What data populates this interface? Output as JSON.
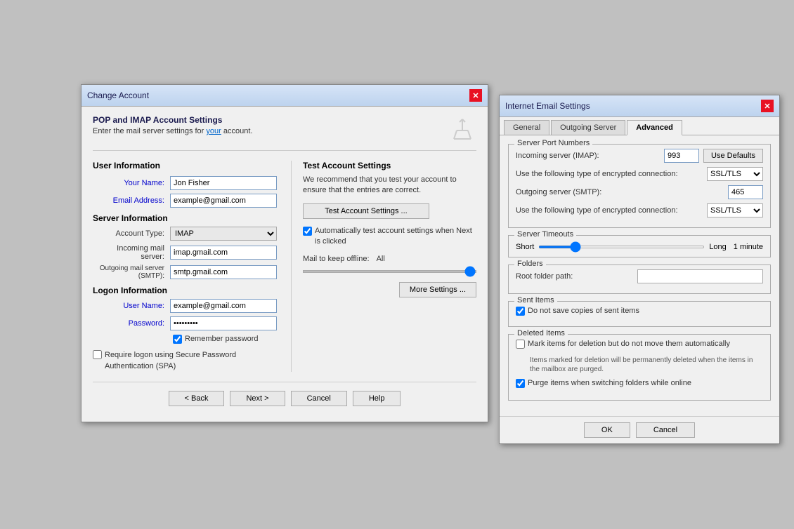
{
  "changeAccount": {
    "title": "Change Account",
    "header": {
      "heading": "POP and IMAP Account Settings",
      "subtext": "Enter the mail server settings for ",
      "link": "your",
      "subtext2": " account."
    },
    "userInfo": {
      "sectionLabel": "User Information",
      "yourNameLabel": "Your Name:",
      "yourNameValue": "Jon Fisher",
      "emailAddressLabel": "Email Address:",
      "emailAddressValue": "example@gmail.com"
    },
    "serverInfo": {
      "sectionLabel": "Server Information",
      "accountTypeLabel": "Account Type:",
      "accountTypeValue": "IMAP",
      "incomingLabel": "Incoming mail server:",
      "incomingValue": "imap.gmail.com",
      "outgoingLabel": "Outgoing mail server (SMTP):",
      "outgoingValue": "smtp.gmail.com"
    },
    "logonInfo": {
      "sectionLabel": "Logon Information",
      "userNameLabel": "User Name:",
      "userNameValue": "example@gmail.com",
      "passwordLabel": "Password:",
      "passwordValue": "********",
      "rememberPassword": "Remember password",
      "spaLabel": "Require logon using Secure Password Authentication (SPA)"
    },
    "testAccountSettings": {
      "title": "Test Account Settings",
      "description": "We recommend that you test your account to ensure that the entries are correct.",
      "testBtnLabel": "Test Account Settings ...",
      "autoTestLabel": "Automatically test account settings when Next is clicked",
      "autoTestChecked": true,
      "mailOfflineLabel": "Mail to keep offline:",
      "mailOfflineValue": "All",
      "moreSettingsLabel": "More Settings ..."
    },
    "buttons": {
      "back": "< Back",
      "next": "Next >",
      "cancel": "Cancel",
      "help": "Help"
    }
  },
  "emailSettings": {
    "title": "Internet Email Settings",
    "tabs": [
      {
        "label": "General",
        "active": false
      },
      {
        "label": "Outgoing Server",
        "active": false
      },
      {
        "label": "Advanced",
        "active": true
      }
    ],
    "serverPortNumbers": {
      "groupTitle": "Server Port Numbers",
      "incomingLabel": "Incoming server (IMAP):",
      "incomingValue": "993",
      "useDefaultsLabel": "Use Defaults",
      "encryptedLabel1": "Use the following type of encrypted connection:",
      "encryptedValue1": "SSL/TLS",
      "outgoingLabel": "Outgoing server (SMTP):",
      "outgoingValue": "465",
      "encryptedLabel2": "Use the following type of encrypted connection:",
      "encryptedValue2": "SSL/TLS"
    },
    "serverTimeouts": {
      "groupTitle": "Server Timeouts",
      "shortLabel": "Short",
      "longLabel": "Long",
      "timeoutValue": "1 minute"
    },
    "folders": {
      "groupTitle": "Folders",
      "rootFolderLabel": "Root folder path:",
      "rootFolderValue": ""
    },
    "sentItems": {
      "groupTitle": "Sent Items",
      "doNotSaveLabel": "Do not save copies of sent items",
      "doNotSaveChecked": true
    },
    "deletedItems": {
      "groupTitle": "Deleted Items",
      "markForDeletionLabel": "Mark items for deletion but do not move them automatically",
      "markForDeletionChecked": false,
      "noteText": "Items marked for deletion will be permanently deleted when the items in the mailbox are purged.",
      "purgeLabel": "Purge items when switching folders while online",
      "purgeChecked": true
    },
    "buttons": {
      "ok": "OK",
      "cancel": "Cancel"
    }
  }
}
